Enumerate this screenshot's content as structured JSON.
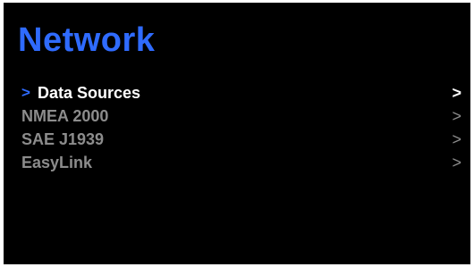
{
  "header": {
    "title": "Network"
  },
  "menu": {
    "selection_marker": ">",
    "items": [
      {
        "label": "Data Sources",
        "chevron": ">",
        "selected": true
      },
      {
        "label": "NMEA 2000",
        "chevron": ">",
        "selected": false
      },
      {
        "label": "SAE J1939",
        "chevron": ">",
        "selected": false
      },
      {
        "label": "EasyLink",
        "chevron": ">",
        "selected": false
      }
    ]
  },
  "colors": {
    "background": "#000000",
    "accent": "#2f6bff",
    "selected_text": "#ffffff",
    "unselected_text": "#8c8c8c"
  }
}
